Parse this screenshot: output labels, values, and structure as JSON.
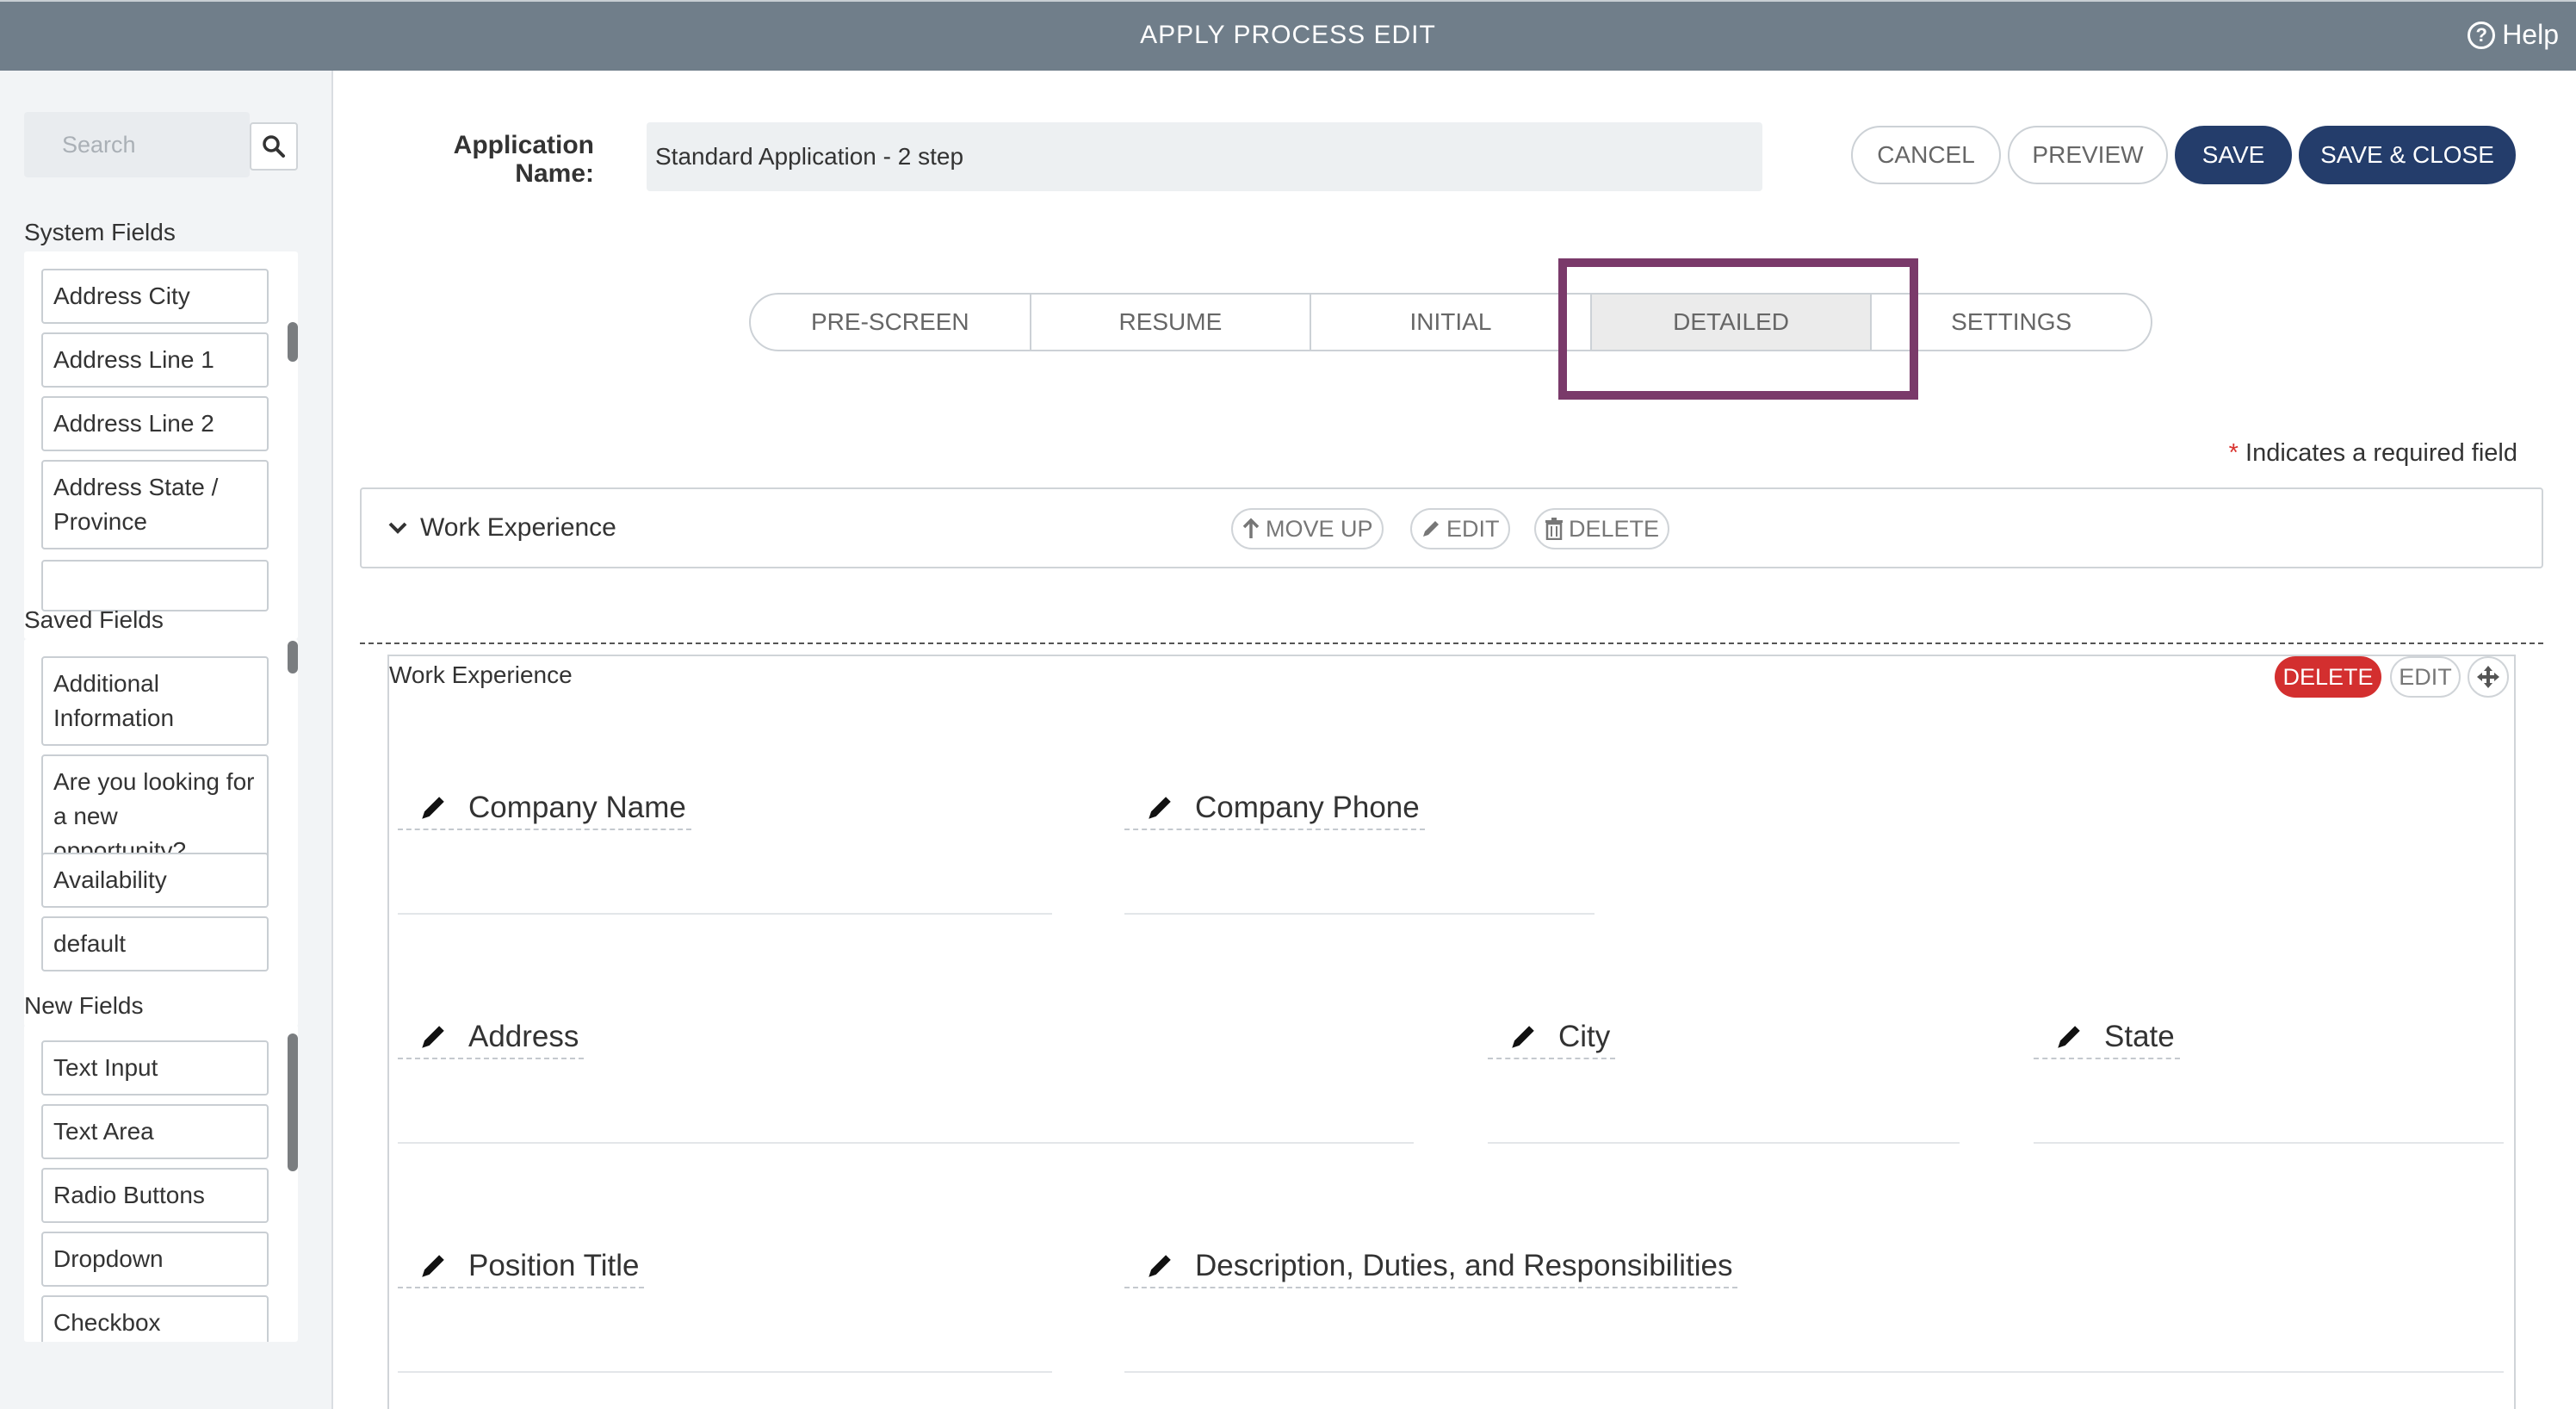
{
  "header": {
    "title": "APPLY PROCESS EDIT",
    "help_label": "Help",
    "help_icon": "question-circle-icon"
  },
  "sidebar": {
    "search": {
      "placeholder": "Search",
      "icon": "search-icon"
    },
    "system_fields": {
      "title": "System Fields",
      "items": [
        "Address City",
        "Address Line 1",
        "Address Line 2",
        "Address State / Province"
      ]
    },
    "saved_fields": {
      "title": "Saved Fields",
      "items": [
        "Additional Information",
        "Are you looking for a new opportunity?",
        "Availability",
        "default"
      ]
    },
    "new_fields": {
      "title": "New Fields",
      "items": [
        "Text Input",
        "Text Area",
        "Radio Buttons",
        "Dropdown",
        "Checkbox"
      ]
    }
  },
  "form": {
    "app_name_label": "Application Name:",
    "app_name_value": "Standard Application - 2 step",
    "buttons": {
      "cancel": "CANCEL",
      "preview": "PREVIEW",
      "save": "SAVE",
      "save_close": "SAVE & CLOSE"
    },
    "tabs": [
      "PRE-SCREEN",
      "RESUME",
      "INITIAL",
      "DETAILED",
      "SETTINGS"
    ],
    "active_tab": "DETAILED",
    "required_note": {
      "star": "*",
      "text": "Indicates a required field"
    }
  },
  "section": {
    "title": "Work Experience",
    "actions": {
      "move_up": "MOVE UP",
      "edit": "EDIT",
      "delete": "DELETE"
    }
  },
  "group": {
    "title": "Work Experience",
    "actions": {
      "delete": "DELETE",
      "edit": "EDIT"
    },
    "fields": [
      "Company Name",
      "Company Phone",
      "Address",
      "City",
      "State",
      "Position Title",
      "Description, Duties, and Responsibilities"
    ]
  },
  "colors": {
    "header_bg": "#707e8a",
    "primary": "#243d6b",
    "danger": "#d32f2f",
    "highlight": "#7a3a6a"
  }
}
